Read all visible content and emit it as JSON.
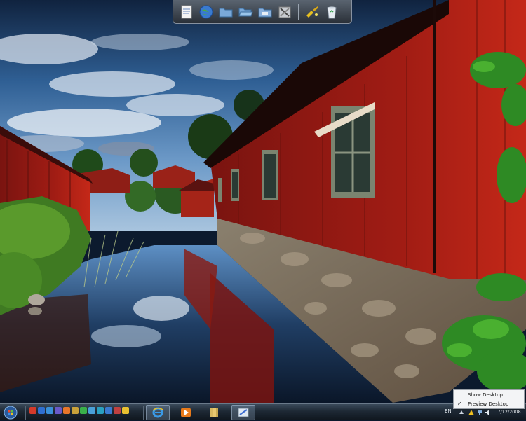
{
  "dock": {
    "items": [
      {
        "name": "document-icon"
      },
      {
        "name": "globe-icon"
      },
      {
        "name": "folder-icon"
      },
      {
        "name": "folder-open-icon"
      },
      {
        "name": "folder-icon"
      },
      {
        "name": "tools-icon"
      },
      {
        "name": "cleaner-icon"
      },
      {
        "name": "recycle-bin-icon"
      }
    ]
  },
  "taskbar": {
    "quick_launch_colors": [
      "#d43a2a",
      "#2f6fd0",
      "#3a90d8",
      "#6a5ac8",
      "#e8762a",
      "#c9a23a",
      "#3ab04a",
      "#4aa0d8",
      "#2aa0c0",
      "#3a7ad0",
      "#c04040",
      "#e8c030"
    ],
    "buttons": [
      {
        "name": "taskbar-ie-button",
        "icon": "internet-explorer-icon",
        "active": true
      },
      {
        "name": "taskbar-media-player-button",
        "icon": "media-player-icon",
        "active": false
      },
      {
        "name": "taskbar-library-button",
        "icon": "library-icon",
        "active": false
      },
      {
        "name": "taskbar-app-button",
        "icon": "window-icon",
        "active": true
      }
    ],
    "tray": {
      "language": "EN",
      "date": "7/12/2008"
    }
  },
  "popup": {
    "show_desktop": "Show Desktop",
    "preview_desktop": "Preview Desktop",
    "preview_checked": true
  }
}
